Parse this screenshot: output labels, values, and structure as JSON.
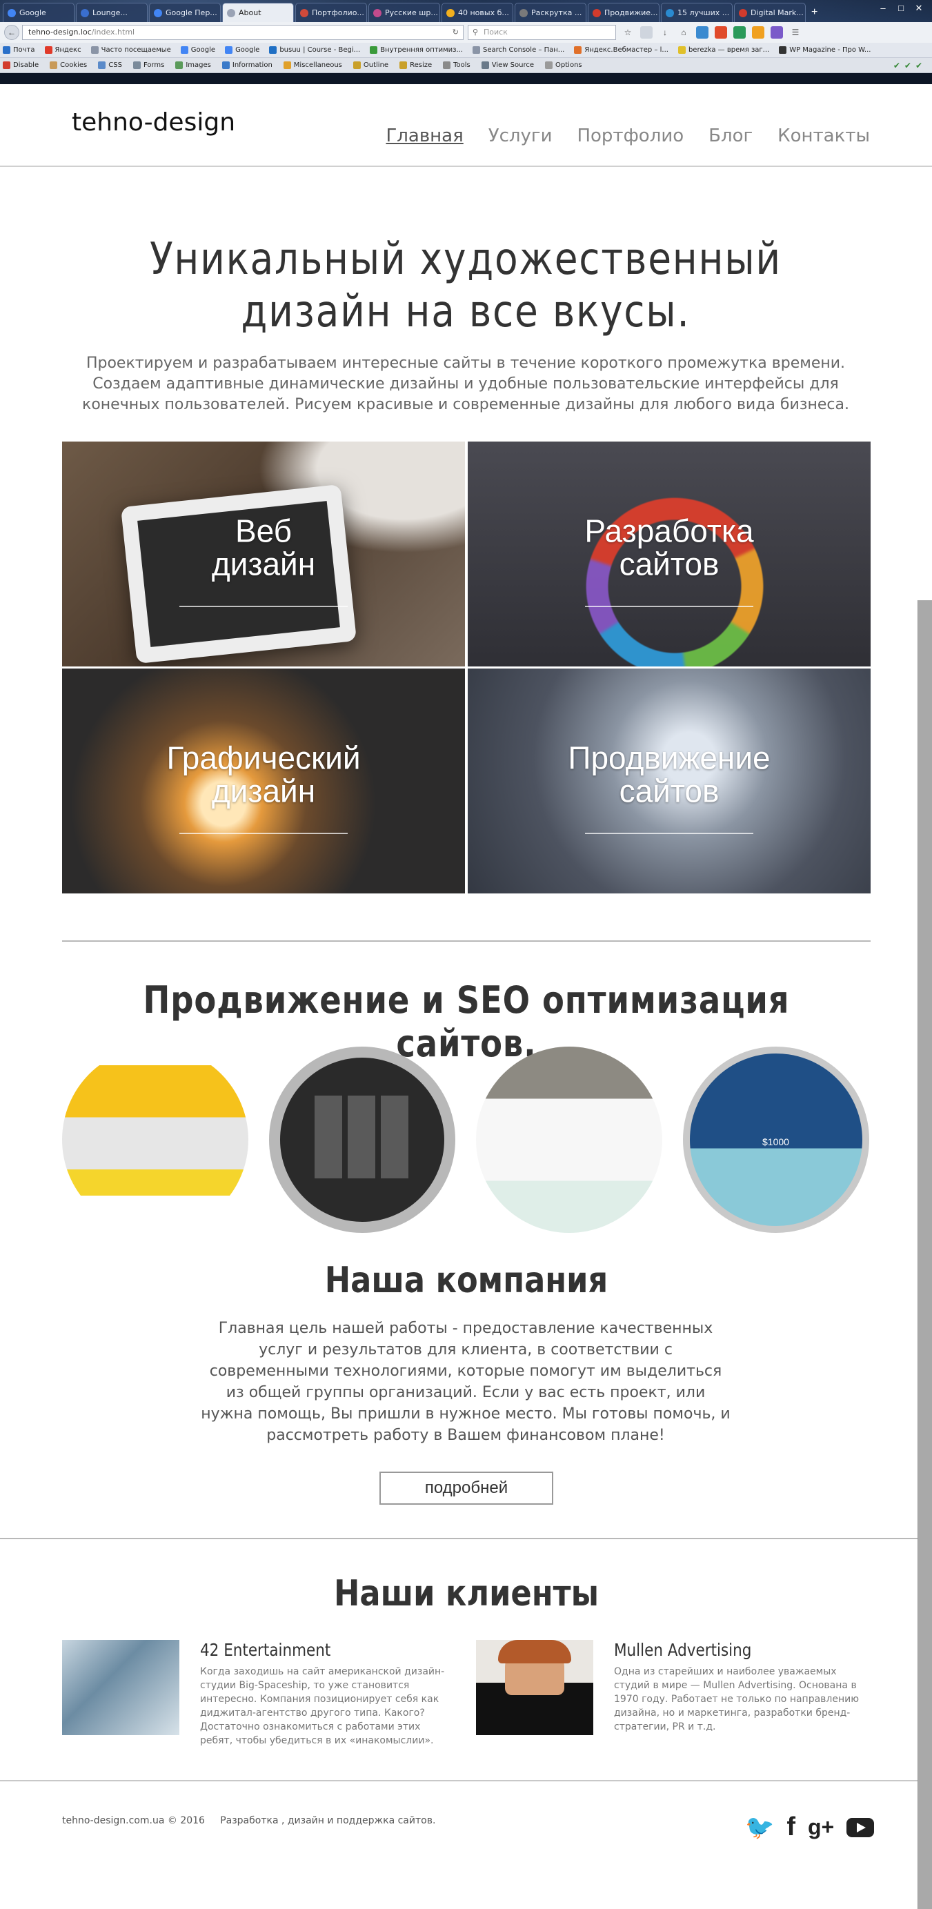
{
  "browser": {
    "tabs": [
      {
        "label": "Google",
        "color": "#4285f4",
        "active": false
      },
      {
        "label": "Lounge...",
        "color": "#3a6fcf",
        "active": false
      },
      {
        "label": "Google Пер...",
        "color": "#4285f4",
        "active": false
      },
      {
        "label": "About",
        "color": "#9aa3b5",
        "active": true
      },
      {
        "label": "Портфолио...",
        "color": "#d04a3a",
        "active": false
      },
      {
        "label": "Русские шр...",
        "color": "#c24b8c",
        "active": false
      },
      {
        "label": "40 новых б...",
        "color": "#f2b01e",
        "active": false
      },
      {
        "label": "Раскрутка ...",
        "color": "#7a7a7a",
        "active": false
      },
      {
        "label": "Продвижие...",
        "color": "#d23b2d",
        "active": false
      },
      {
        "label": "15 лучших ...",
        "color": "#2a8ad0",
        "active": false
      },
      {
        "label": "Digital Mark...",
        "color": "#d23b2d",
        "active": false
      }
    ],
    "new_tab": "+",
    "url_host": "tehno-design.loc",
    "url_path": "/index.html",
    "search_placeholder": "Поиск",
    "bookmarks": [
      "Почта",
      "Яндекс",
      "Часто посещаемые",
      "Google",
      "Google",
      "busuu | Course - Begi...",
      "Внутренняя оптимиз...",
      "Search Console – Пан...",
      "Яндекс.Вебмастер – l...",
      "berezka — время заг...",
      "WP Magazine - Про W..."
    ],
    "devtools": [
      "Disable",
      "Cookies",
      "CSS",
      "Forms",
      "Images",
      "Information",
      "Miscellaneous",
      "Outline",
      "Resize",
      "Tools",
      "View Source",
      "Options"
    ]
  },
  "site": {
    "logo": "tehno-design",
    "nav": [
      "Главная",
      "Услуги",
      "Портфолио",
      "Блог",
      "Контакты"
    ],
    "hero_title": "Уникальный художественный дизайн на все вкусы.",
    "hero_sub": "Проектируем и разрабатываем интересные сайты в течение короткого промежутка времени. Создаем адаптивные динамические дизайны и удобные пользовательские интерфейсы для конечных пользователей. Рисуем красивые и современные дизайны для любого вида бизнеса.",
    "services": [
      {
        "line1": "Веб",
        "line2": "дизайн"
      },
      {
        "line1": "Разработка",
        "line2": "сайтов"
      },
      {
        "line1": "Графический",
        "line2": "дизайн"
      },
      {
        "line1": "Продвижение",
        "line2": "сайтов"
      }
    ],
    "seo_title": "Продвижение и SEO оптимизация сайтов.",
    "portfolio_price": "$1000",
    "company_title": "Наша компания",
    "company_text": "Главная цель нашей работы - предоставление качественных услуг и результатов для клиента, в соответствии с современными технологиями, которые помогут им выделиться из общей группы организаций. Если у вас есть проект, или нужна помощь, Вы пришли в нужное место. Мы готовы помочь, и рассмотреть работу в Вашем финансовом плане!",
    "more_button": "подробней",
    "clients_title": "Наши клиенты",
    "clients": [
      {
        "name": "42 Entertainment",
        "text": "Когда заходишь на сайт американской дизайн-студии Big-Spaceship, то уже становится интересно. Компания позиционирует себя как диджитал-агентство другого типа. Какого? Достаточно ознакомиться с работами этих ребят, чтобы убедиться в их «инакомыслии»."
      },
      {
        "name": "Mullen Advertising",
        "text": "Одна из старейших и наиболее уважаемых студий в мире — Mullen Advertising. Основана в 1970 году. Работает не только по направлению дизайна, но и маркетинга, разработки бренд-стратегии, PR и т.д."
      }
    ],
    "footer": "tehno-design.com.ua © 2016     Разработка , дизайн и поддержка сайтов.",
    "social": [
      "twitter-icon",
      "facebook-icon",
      "google-plus-icon",
      "youtube-icon"
    ]
  }
}
